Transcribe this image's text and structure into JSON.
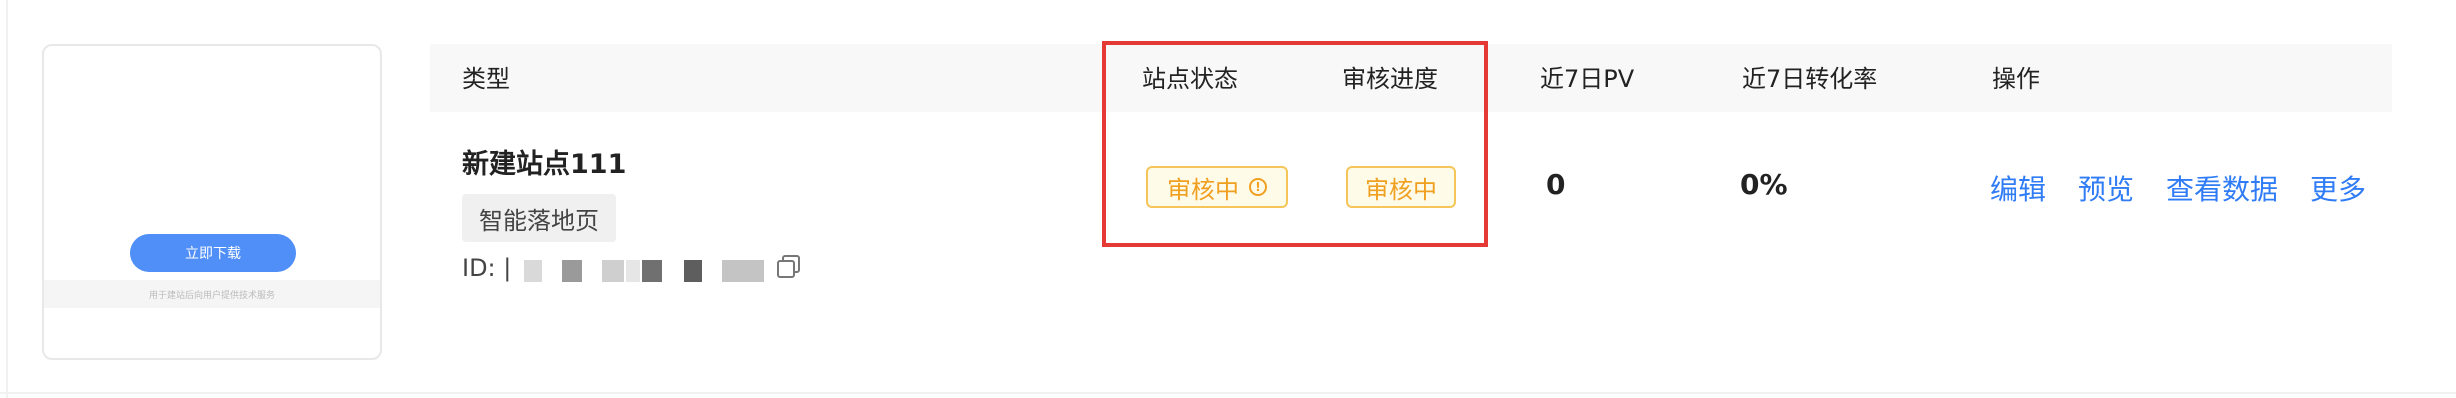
{
  "preview": {
    "button_label": "立即下载",
    "footer_text": "用于建站后向用户提供技术服务"
  },
  "table": {
    "headers": {
      "type": "类型",
      "site_status": "站点状态",
      "review_progress": "审核进度",
      "pv_7d": "近7日PV",
      "conversion_7d": "近7日转化率",
      "actions": "操作"
    },
    "row": {
      "name": "新建站点111",
      "tag": "智能落地页",
      "id_label": "ID: |",
      "site_status": "审核中",
      "review_progress": "审核中",
      "pv_7d": "0",
      "conversion_7d": "0%",
      "actions": {
        "edit": "编辑",
        "preview": "预览",
        "view_data": "查看数据",
        "more": "更多"
      }
    }
  },
  "colors": {
    "link": "#2f7cf6",
    "warning": "#f0a020",
    "highlight": "#e53935"
  },
  "icons": {
    "copy": "copy-icon",
    "status_warning": "warning-circle-icon"
  }
}
